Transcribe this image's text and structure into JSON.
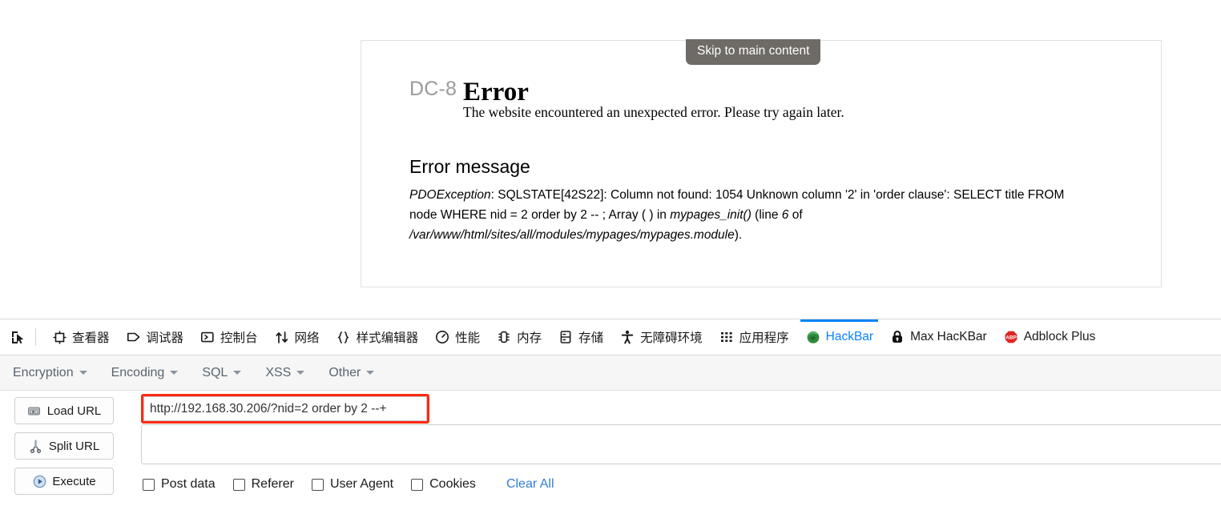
{
  "page": {
    "skip_link": "Skip to main content",
    "site_name": "DC-8",
    "title": "Error",
    "intro": "The website encountered an unexpected error. Please try again later.",
    "error_heading": "Error message",
    "error_message": {
      "exception": "PDOException",
      "part1": ": SQLSTATE[42S22]: Column not found: 1054 Unknown column '2' in 'order clause': SELECT title FROM node WHERE nid = 2 order by 2 -- ; Array ( ) in ",
      "function": "mypages_init()",
      "part2": " (line ",
      "line_number": "6",
      "part3": " of ",
      "file_path": "/var/www/html/sites/all/modules/mypages/mypages.module",
      "part4": ")."
    }
  },
  "devtools": {
    "picker_icon": "element-picker-icon",
    "tabs": [
      {
        "label": "查看器",
        "icon": "inspector-icon",
        "active": false
      },
      {
        "label": "调试器",
        "icon": "debugger-icon",
        "active": false
      },
      {
        "label": "控制台",
        "icon": "console-icon",
        "active": false
      },
      {
        "label": "网络",
        "icon": "network-icon",
        "active": false
      },
      {
        "label": "样式编辑器",
        "icon": "style-editor-icon",
        "active": false
      },
      {
        "label": "性能",
        "icon": "performance-icon",
        "active": false
      },
      {
        "label": "内存",
        "icon": "memory-icon",
        "active": false
      },
      {
        "label": "存储",
        "icon": "storage-icon",
        "active": false
      },
      {
        "label": "无障碍环境",
        "icon": "accessibility-icon",
        "active": false
      },
      {
        "label": "应用程序",
        "icon": "application-icon",
        "active": false
      },
      {
        "label": "HackBar",
        "icon": "hackbar-icon",
        "active": true
      },
      {
        "label": "Max HacKBar",
        "icon": "lock-icon",
        "active": false
      },
      {
        "label": "Adblock Plus",
        "icon": "adblock-plus-icon",
        "active": false
      }
    ],
    "active_tab_color": "#0a84ff"
  },
  "hackbar": {
    "menu": [
      {
        "label": "Encryption"
      },
      {
        "label": "Encoding"
      },
      {
        "label": "SQL"
      },
      {
        "label": "XSS"
      },
      {
        "label": "Other"
      }
    ],
    "buttons": [
      {
        "label": "Load URL",
        "icon": "load-url-icon"
      },
      {
        "label": "Split URL",
        "icon": "scissors-icon"
      },
      {
        "label": "Execute",
        "icon": "play-icon"
      }
    ],
    "url_value": "http://192.168.30.206/?nid=2 order by 2 --+",
    "url_placeholder": "",
    "url_highlight_color": "#fc2a11",
    "body_value": "",
    "body_placeholder": "",
    "options": [
      {
        "label": "Post data",
        "checked": false
      },
      {
        "label": "Referer",
        "checked": false
      },
      {
        "label": "User Agent",
        "checked": false
      },
      {
        "label": "Cookies",
        "checked": false
      }
    ],
    "clear_all_label": "Clear All",
    "clear_all_color": "#2f7ddb"
  }
}
